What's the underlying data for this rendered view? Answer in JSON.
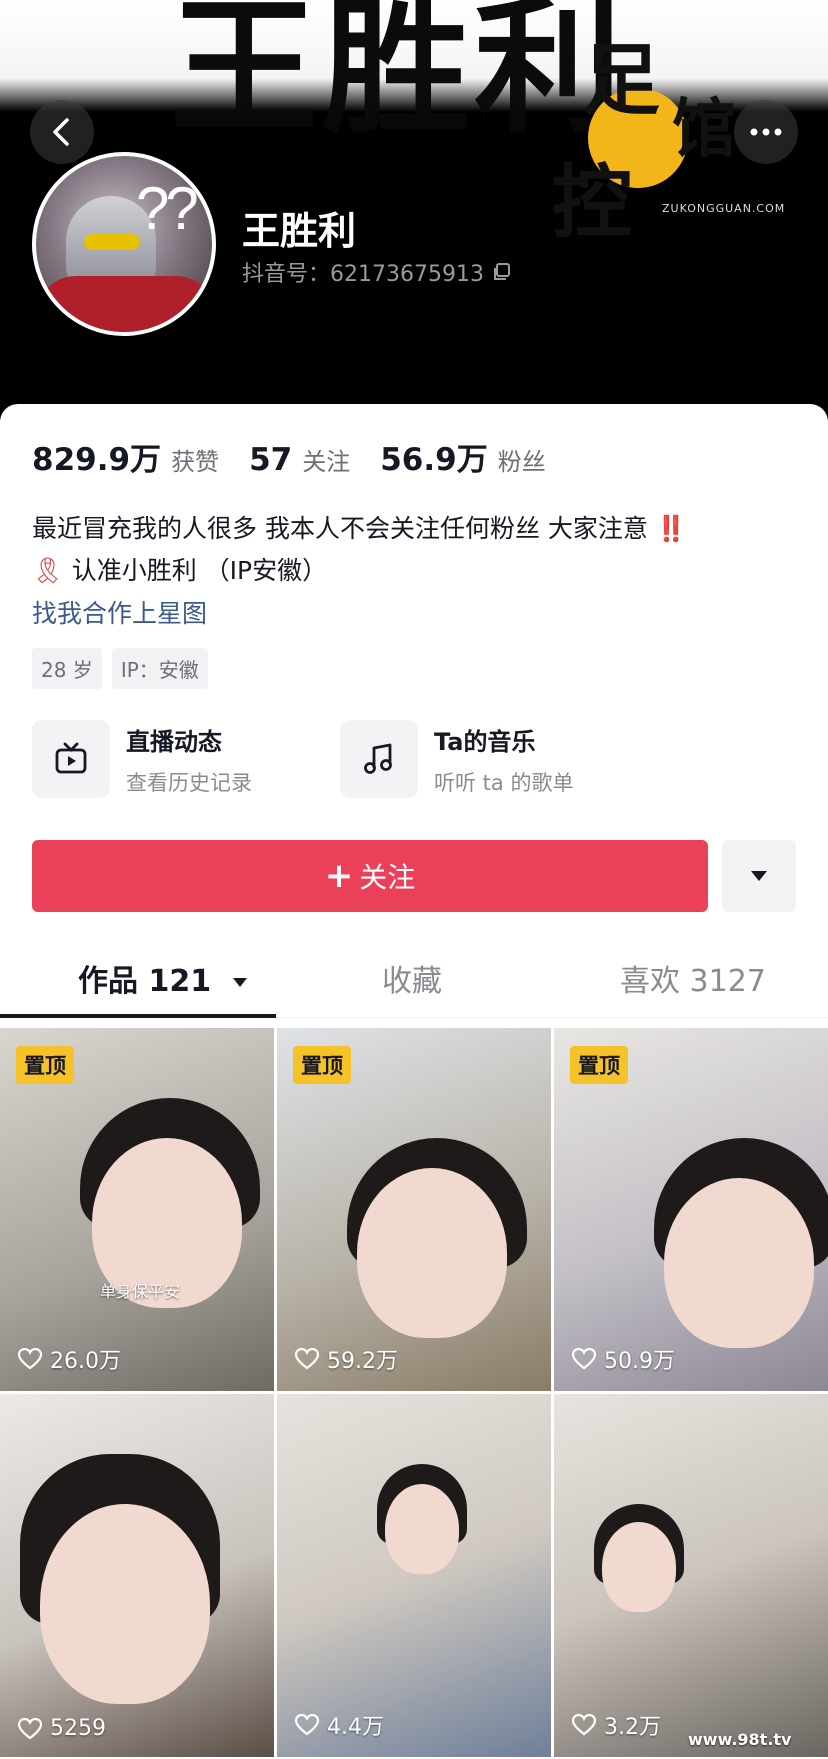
{
  "header": {
    "banner_text": "王胜利",
    "username": "王胜利",
    "douyin_id": "抖音号：62173675913",
    "watermark": {
      "chars": [
        "足",
        "馆",
        "控"
      ],
      "url": "ZUKONGGUAN.COM"
    }
  },
  "stats": [
    {
      "value": "829.9万",
      "label": "获赞"
    },
    {
      "value": "57",
      "label": "关注"
    },
    {
      "value": "56.9万",
      "label": "粉丝"
    }
  ],
  "bio": {
    "line1": "最近冒充我的人很多 我本人不会关注任何粉丝 大家注意",
    "line1_mark": "‼️",
    "line2_icon": "🎗",
    "line2": "认准小胜利 （IP安徽）",
    "link": "找我合作上星图"
  },
  "tags": [
    "28 岁",
    "IP：安徽"
  ],
  "features": [
    {
      "title": "直播动态",
      "subtitle": "查看历史记录",
      "icon": "tv-icon"
    },
    {
      "title": "Ta的音乐",
      "subtitle": "听听 ta 的歌单",
      "icon": "music-note-icon"
    }
  ],
  "actions": {
    "follow_plus": "+",
    "follow_label": "关注"
  },
  "tabs": [
    {
      "label": "作品 121",
      "active": true
    },
    {
      "label": "收藏",
      "active": false
    },
    {
      "label": "喜欢 3127",
      "active": false
    }
  ],
  "videos": [
    {
      "pinned": true,
      "pin_label": "置顶",
      "likes": "26.0万",
      "caption": "单身保平安"
    },
    {
      "pinned": true,
      "pin_label": "置顶",
      "likes": "59.2万"
    },
    {
      "pinned": true,
      "pin_label": "置顶",
      "likes": "50.9万"
    },
    {
      "pinned": false,
      "likes": "5259"
    },
    {
      "pinned": false,
      "likes": "4.4万"
    },
    {
      "pinned": false,
      "likes": "3.2万"
    }
  ],
  "site_watermark": "www.98t.tv",
  "colors": {
    "accent": "#ea4059",
    "header_bg": "#000000",
    "pin_badge": "#f6c22a",
    "link": "#3c5a8a"
  }
}
